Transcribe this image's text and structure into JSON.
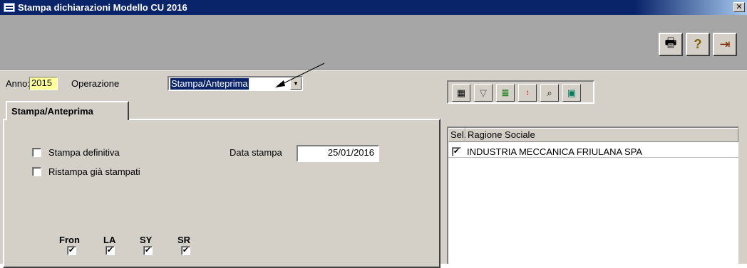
{
  "window": {
    "title": "Stampa dichiarazioni Modello CU 2016",
    "close_glyph": "✕"
  },
  "toolbar": {
    "buttons": [
      {
        "name": "print-icon",
        "glyph": "🖶"
      },
      {
        "name": "help-icon",
        "glyph": "?"
      },
      {
        "name": "exit-icon",
        "glyph": "⇥"
      }
    ]
  },
  "form": {
    "anno_label": "Anno:",
    "anno_value": "2015",
    "operazione_label": "Operazione",
    "operazione_value": "Stampa/Anteprima",
    "dropdown_arrow": "▼"
  },
  "tab": {
    "label": "Stampa/Anteprima"
  },
  "options": {
    "stampa_definitiva": {
      "label": "Stampa definitiva",
      "checked": false
    },
    "ristampa": {
      "label": "Ristampa già stampati",
      "checked": false
    },
    "data_stampa_label": "Data stampa",
    "data_stampa_value": "25/01/2016"
  },
  "columns": [
    {
      "label": "Fron",
      "checked": true
    },
    {
      "label": "LA",
      "checked": true
    },
    {
      "label": "SY",
      "checked": true
    },
    {
      "label": "SR",
      "checked": true
    }
  ],
  "right_toolbar": {
    "buttons": [
      "grid-icon",
      "filter-icon",
      "traffic-light-icon",
      "sort-icon",
      "binoculars-icon",
      "book-icon"
    ]
  },
  "grid": {
    "headers": [
      "Sel.",
      "Ragione Sociale"
    ],
    "rows": [
      {
        "selected": true,
        "ragione_sociale": "INDUSTRIA MECCANICA FRIULANA SPA"
      }
    ]
  },
  "check_glyph": "✔"
}
